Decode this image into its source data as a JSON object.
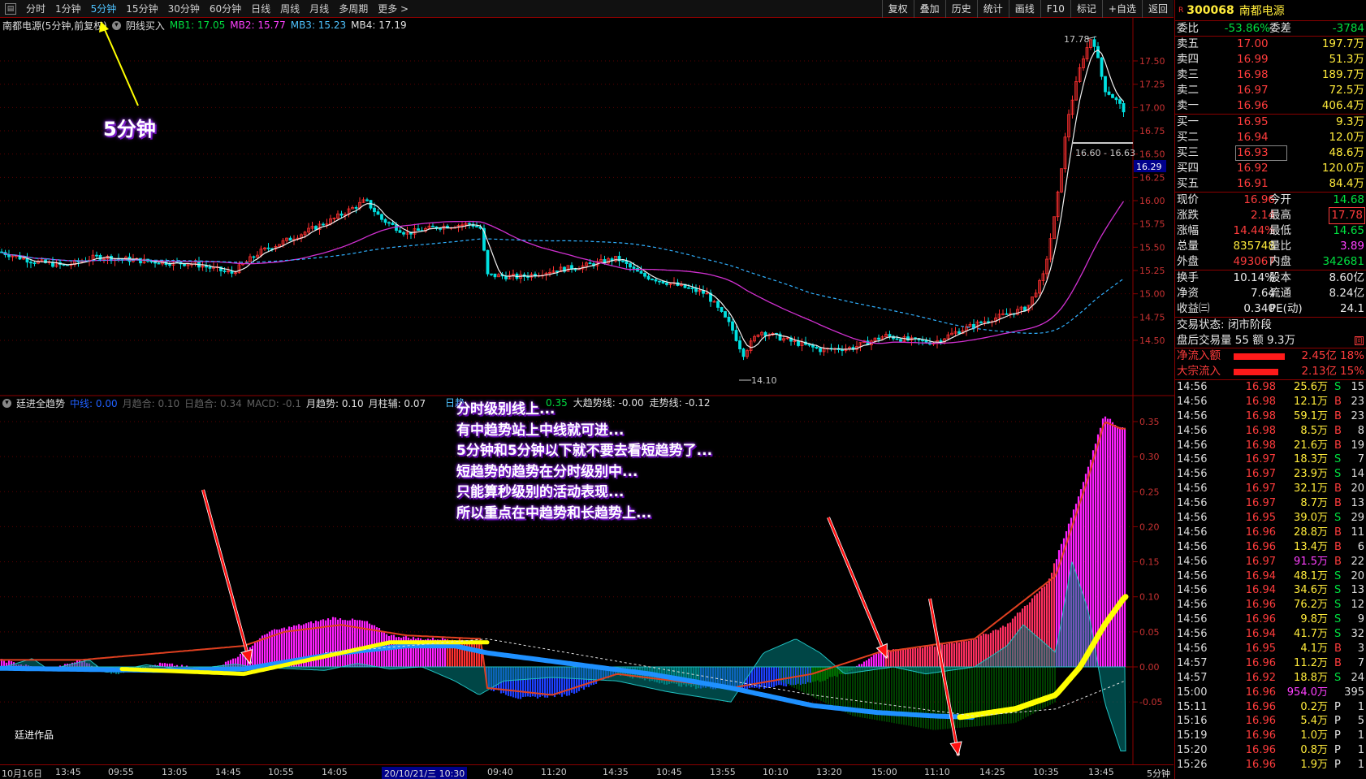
{
  "toolbar": {
    "periods": [
      "分时",
      "1分钟",
      "5分钟",
      "15分钟",
      "30分钟",
      "60分钟",
      "日线",
      "周线",
      "月线",
      "多周期",
      "更多 >"
    ],
    "active_period": "5分钟",
    "tools": [
      "复权",
      "叠加",
      "历史",
      "统计",
      "画线",
      "F10",
      "标记",
      "+自选",
      "返回"
    ]
  },
  "main_chart": {
    "title": "南都电源(5分钟,前复权)",
    "indicator": "阴线买入",
    "mb": [
      {
        "label": "MB1: 17.05",
        "color": "#00e040"
      },
      {
        "label": "MB2: 15.77",
        "color": "#ff40ff"
      },
      {
        "label": "MB3: 15.23",
        "color": "#4fc3ff"
      },
      {
        "label": "MB4: 17.19",
        "color": "#e0e0e0"
      }
    ],
    "y_ticks": [
      "17.50",
      "17.25",
      "17.00",
      "16.75",
      "16.50",
      "16.25",
      "16.00",
      "15.75",
      "15.50",
      "15.25",
      "15.00",
      "14.75",
      "14.50"
    ],
    "current_price_tag": "16.29",
    "high_label": "17.78",
    "low_label": "14.10",
    "range_label": "16.60 - 16.63",
    "annotation": "5分钟"
  },
  "sub_chart": {
    "title": "廷进全趋势",
    "items": [
      {
        "label": "中线: 0.00",
        "color": "#2060ff"
      },
      {
        "label": "月趋合: 0.10",
        "color": "#606060"
      },
      {
        "label": "日趋合: 0.34",
        "color": "#606060"
      },
      {
        "label": "MACD: -0.1",
        "color": "#606060"
      },
      {
        "label": "月趋势: 0.10",
        "color": "#e0e0e0"
      },
      {
        "label": "月柱辅: 0.07",
        "color": "#e0e0e0"
      }
    ],
    "items_right": [
      {
        "label": "0.35",
        "color": "#00e040"
      },
      {
        "label": "大趋势线: -0.00",
        "color": "#e0e0e0"
      },
      {
        "label": "走势线: -0.12",
        "color": "#e0e0e0"
      }
    ],
    "lead_label": "日趋",
    "y_ticks": [
      "0.35",
      "0.30",
      "0.25",
      "0.20",
      "0.15",
      "0.10",
      "0.05",
      "0.00",
      "-0.05"
    ],
    "annotation_lines": [
      "分时级别线上...",
      "有中趋势站上中线就可进...",
      "5分钟和5分钟以下就不要去看短趋势了...",
      "短趋势的趋势在分时级别中...",
      "只能算秒级别的活动表现...",
      "所以重点在中趋势和长趋势上..."
    ],
    "author": "廷进作品"
  },
  "time_axis": {
    "ticks": [
      "10月16日",
      "13:45",
      "09:55",
      "13:05",
      "14:45",
      "10:55",
      "14:05",
      "20/10/21/三 10:30",
      "09:40",
      "11:20",
      "14:35",
      "10:45",
      "13:55",
      "10:10",
      "13:20",
      "15:00",
      "11:10",
      "14:25",
      "10:35",
      "13:45"
    ],
    "highlight": "20/10/21/三 10:30",
    "period": "5分钟"
  },
  "quote": {
    "code": "300068",
    "name": "南都电源",
    "r_mark": "R",
    "weibi": {
      "label": "委比",
      "value": "-53.86%",
      "label2": "委差",
      "value2": "-3784"
    },
    "asks": [
      {
        "label": "卖五",
        "price": "17.00",
        "vol": "197.7万"
      },
      {
        "label": "卖四",
        "price": "16.99",
        "vol": "51.3万"
      },
      {
        "label": "卖三",
        "price": "16.98",
        "vol": "189.7万"
      },
      {
        "label": "卖二",
        "price": "16.97",
        "vol": "72.5万"
      },
      {
        "label": "卖一",
        "price": "16.96",
        "vol": "406.4万"
      }
    ],
    "bids": [
      {
        "label": "买一",
        "price": "16.95",
        "vol": "9.3万"
      },
      {
        "label": "买二",
        "price": "16.94",
        "vol": "12.0万"
      },
      {
        "label": "买三",
        "price": "16.93",
        "vol": "48.6万"
      },
      {
        "label": "买四",
        "price": "16.92",
        "vol": "120.0万"
      },
      {
        "label": "买五",
        "price": "16.91",
        "vol": "84.4万"
      }
    ],
    "stats": [
      {
        "l1": "现价",
        "v1": "16.96",
        "c1": "red",
        "l2": "今开",
        "v2": "14.68",
        "c2": "grn"
      },
      {
        "l1": "涨跌",
        "v1": "2.14",
        "c1": "red",
        "l2": "最高",
        "v2": "17.78",
        "c2": "red"
      },
      {
        "l1": "涨幅",
        "v1": "14.44%",
        "c1": "red",
        "l2": "最低",
        "v2": "14.65",
        "c2": "grn"
      },
      {
        "l1": "总量",
        "v1": "835748",
        "c1": "yel",
        "l2": "量比",
        "v2": "3.89",
        "c2": "mag"
      },
      {
        "l1": "外盘",
        "v1": "493067",
        "c1": "red",
        "l2": "内盘",
        "v2": "342681",
        "c2": "grn"
      }
    ],
    "fund": [
      {
        "l1": "换手",
        "v1": "10.14%",
        "l2": "股本",
        "v2": "8.60亿"
      },
      {
        "l1": "净资",
        "v1": "7.64",
        "l2": "流通",
        "v2": "8.24亿"
      },
      {
        "l1": "收益㈢",
        "v1": "0.340",
        "l2": "PE(动)",
        "v2": "24.1"
      }
    ],
    "trade_state": "交易状态: 闭市阶段",
    "after_hours": "盘后交易量 55 额 9.3万",
    "flows": [
      {
        "label": "净流入额",
        "value": "2.45亿",
        "pct": "18%",
        "bar": 0.9
      },
      {
        "label": "大宗流入",
        "value": "2.13亿",
        "pct": "15%",
        "bar": 0.78
      }
    ],
    "ticks": [
      {
        "t": "14:56",
        "p": "16.98",
        "v": "25.6万",
        "s": "S",
        "n": "15"
      },
      {
        "t": "14:56",
        "p": "16.98",
        "v": "12.1万",
        "s": "B",
        "n": "23"
      },
      {
        "t": "14:56",
        "p": "16.98",
        "v": "59.1万",
        "s": "B",
        "n": "23"
      },
      {
        "t": "14:56",
        "p": "16.98",
        "v": "8.5万",
        "s": "B",
        "n": "8"
      },
      {
        "t": "14:56",
        "p": "16.98",
        "v": "21.6万",
        "s": "B",
        "n": "19"
      },
      {
        "t": "14:56",
        "p": "16.97",
        "v": "18.3万",
        "s": "S",
        "n": "7"
      },
      {
        "t": "14:56",
        "p": "16.97",
        "v": "23.9万",
        "s": "S",
        "n": "14"
      },
      {
        "t": "14:56",
        "p": "16.97",
        "v": "32.1万",
        "s": "B",
        "n": "20"
      },
      {
        "t": "14:56",
        "p": "16.97",
        "v": "8.7万",
        "s": "B",
        "n": "13"
      },
      {
        "t": "14:56",
        "p": "16.95",
        "v": "39.0万",
        "s": "S",
        "n": "29"
      },
      {
        "t": "14:56",
        "p": "16.96",
        "v": "28.8万",
        "s": "B",
        "n": "11"
      },
      {
        "t": "14:56",
        "p": "16.96",
        "v": "13.4万",
        "s": "B",
        "n": "6"
      },
      {
        "t": "14:56",
        "p": "16.97",
        "v": "91.5万",
        "s": "B",
        "n": "22"
      },
      {
        "t": "14:56",
        "p": "16.94",
        "v": "48.1万",
        "s": "S",
        "n": "20"
      },
      {
        "t": "14:56",
        "p": "16.94",
        "v": "34.6万",
        "s": "S",
        "n": "13"
      },
      {
        "t": "14:56",
        "p": "16.96",
        "v": "76.2万",
        "s": "S",
        "n": "12"
      },
      {
        "t": "14:56",
        "p": "16.96",
        "v": "9.8万",
        "s": "S",
        "n": "9"
      },
      {
        "t": "14:56",
        "p": "16.94",
        "v": "41.7万",
        "s": "S",
        "n": "32"
      },
      {
        "t": "14:56",
        "p": "16.95",
        "v": "4.1万",
        "s": "B",
        "n": "3"
      },
      {
        "t": "14:57",
        "p": "16.96",
        "v": "11.2万",
        "s": "B",
        "n": "7"
      },
      {
        "t": "14:57",
        "p": "16.92",
        "v": "18.8万",
        "s": "S",
        "n": "24"
      },
      {
        "t": "15:00",
        "p": "16.96",
        "v": "954.0万",
        "s": "",
        "n": "395"
      },
      {
        "t": "15:11",
        "p": "16.96",
        "v": "0.2万",
        "s": "P",
        "n": "1"
      },
      {
        "t": "15:16",
        "p": "16.96",
        "v": "5.4万",
        "s": "P",
        "n": "5"
      },
      {
        "t": "15:19",
        "p": "16.96",
        "v": "1.0万",
        "s": "P",
        "n": "1"
      },
      {
        "t": "15:20",
        "p": "16.96",
        "v": "0.8万",
        "s": "P",
        "n": "1"
      },
      {
        "t": "15:26",
        "p": "16.96",
        "v": "1.9万",
        "s": "P",
        "n": "1"
      }
    ]
  }
}
